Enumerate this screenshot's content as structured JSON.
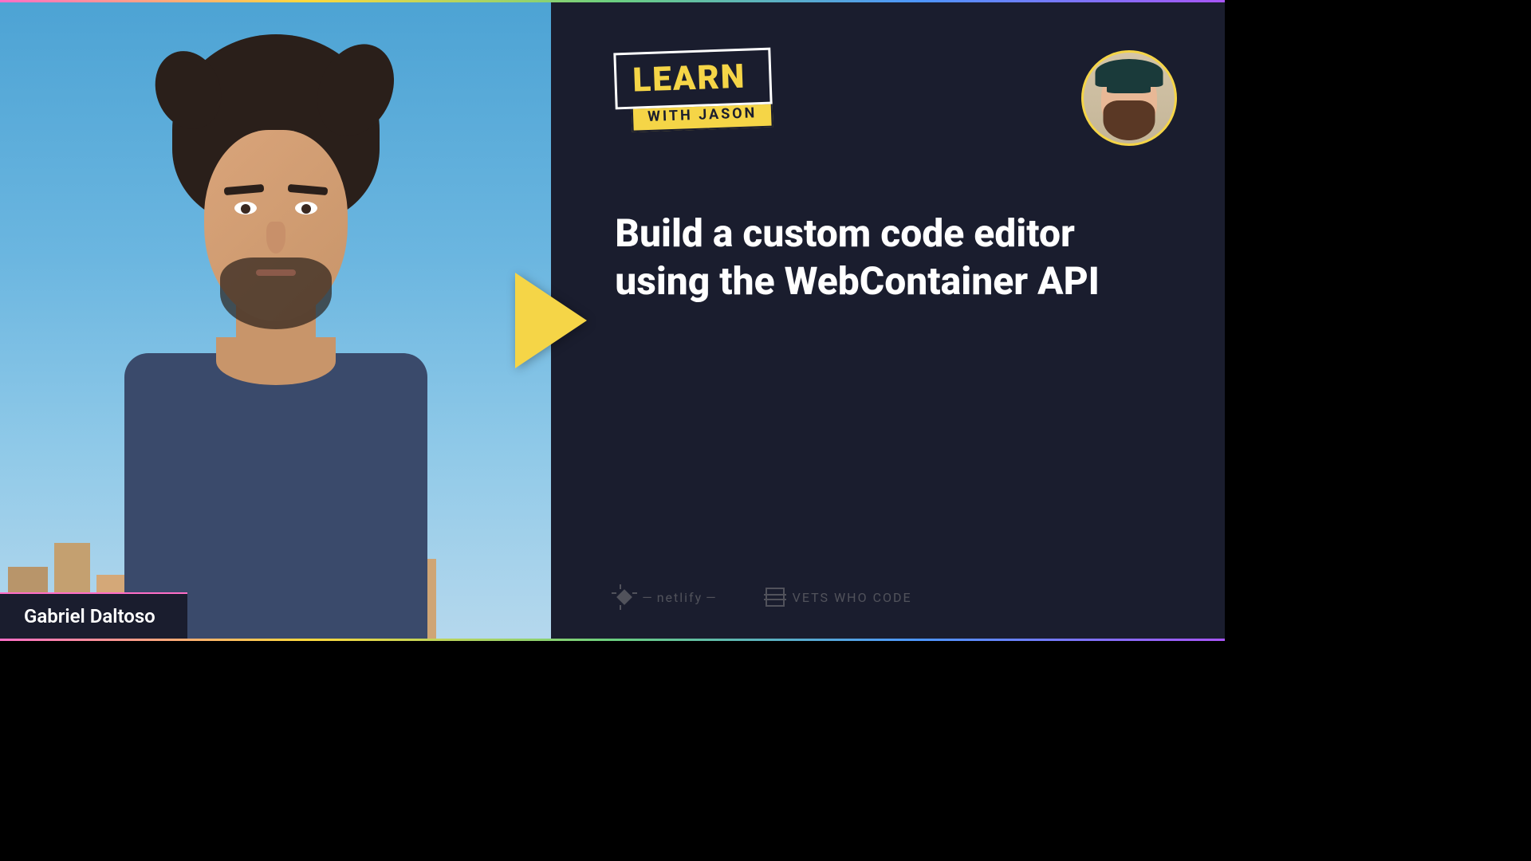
{
  "guest": {
    "name": "Gabriel Daltoso"
  },
  "logo": {
    "learn": "LEARN",
    "with_jason": "WITH JASON"
  },
  "episode": {
    "title": "Build a custom code editor using the WebContainer API"
  },
  "sponsors": {
    "netlify": "netlify",
    "vets_who_code": "VETS WHO CODE"
  }
}
